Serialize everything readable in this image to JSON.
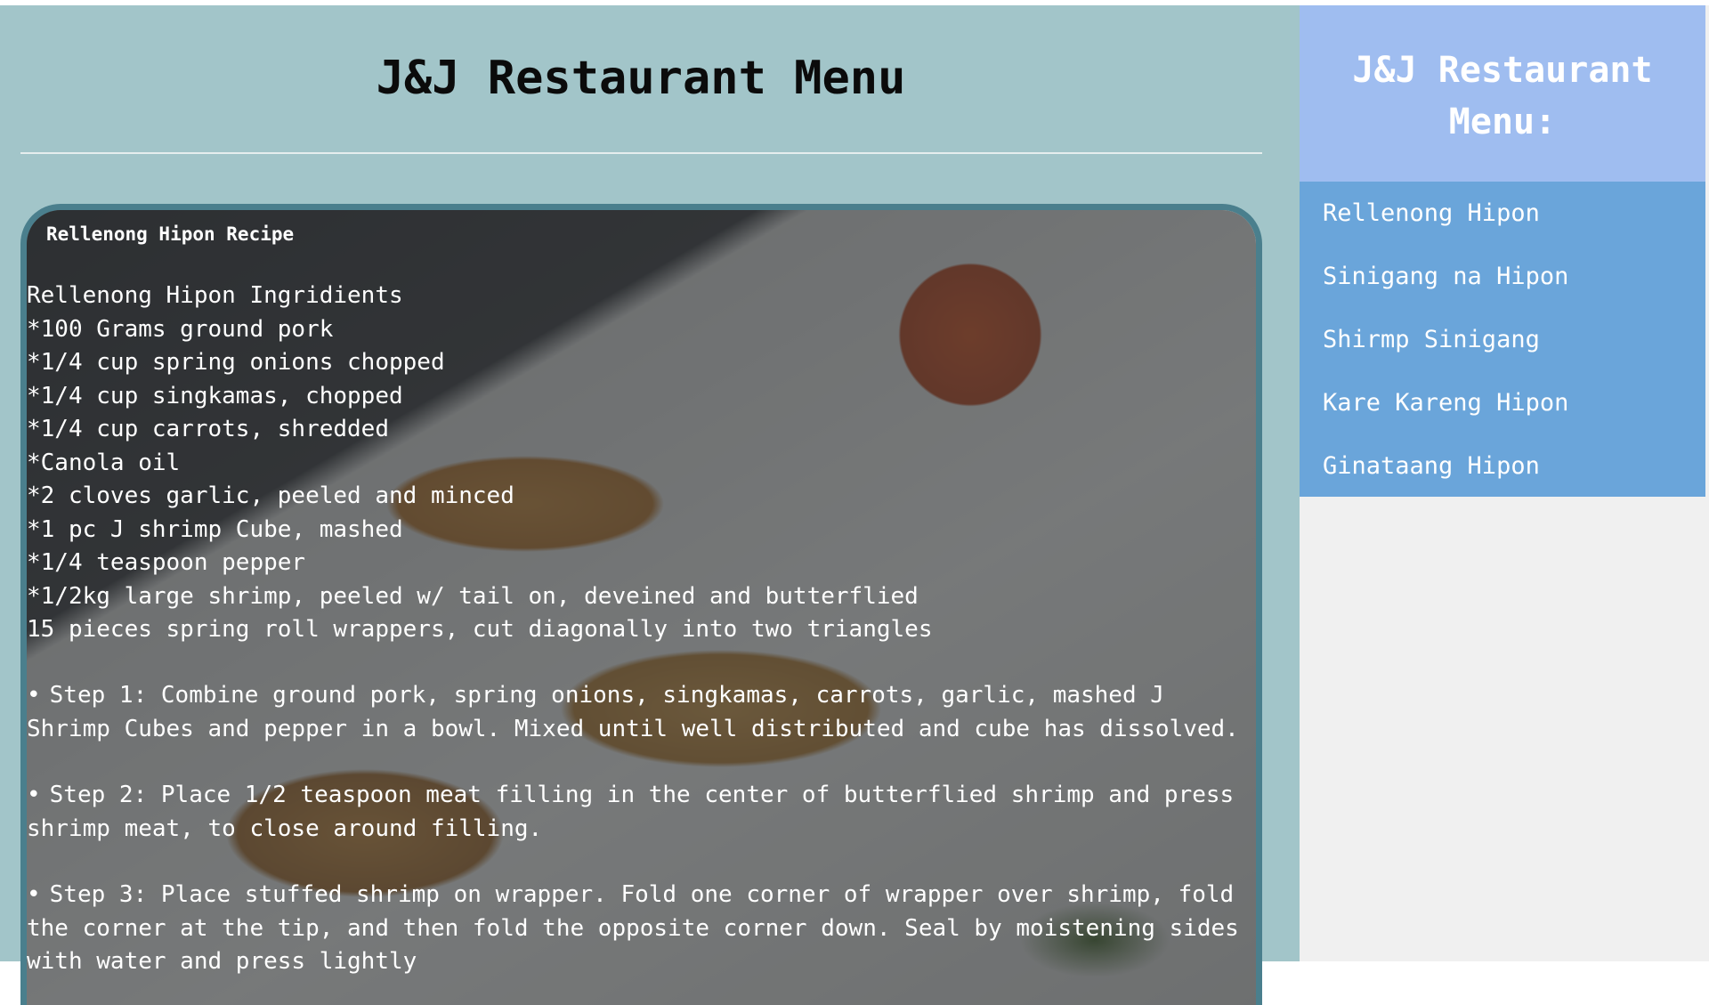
{
  "page": {
    "title": "J&J Restaurant Menu"
  },
  "recipe": {
    "heading": "Rellenong Hipon Recipe",
    "ingredients": [
      "Rellenong Hipon Ingridients",
      "*100 Grams ground pork",
      "*1/4 cup spring onions chopped",
      "*1/4 cup singkamas, chopped",
      "*1/4 cup carrots, shredded",
      "*Canola oil",
      "*2 cloves garlic, peeled and minced",
      "*1 pc J shrimp Cube, mashed",
      "*1/4 teaspoon pepper",
      "*1/2kg large shrimp, peeled w/ tail on, deveined and butterflied",
      "15 pieces spring roll wrappers, cut diagonally into two triangles"
    ],
    "steps": [
      "Step 1: Combine ground pork, spring onions, singkamas, carrots, garlic, mashed J Shrimp Cubes and pepper in a bowl. Mixed until well distributed and cube has dissolved.",
      "Step 2: Place 1/2 teaspoon meat filling in the center of butterflied shrimp and press shrimp meat, to close around filling.",
      "Step 3: Place stuffed shrimp on wrapper. Fold one corner of wrapper over shrimp, fold the corner at the tip, and then fold the opposite corner down. Seal by moistening sides with water and press lightly"
    ],
    "bullet": "•"
  },
  "sidebar": {
    "title": "J&J Restaurant Menu:",
    "items": [
      "Rellenong Hipon",
      "Sinigang na Hipon",
      "Shirmp Sinigang",
      "Kare Kareng Hipon",
      "Ginataang Hipon"
    ]
  },
  "colors": {
    "main_bg": "#a2c5c9",
    "card_border": "#4a7f8d",
    "sidebar_header_bg": "#9fbdf0",
    "sidebar_nav_bg": "#6aa5da",
    "sidebar_bg": "#f0f0f0"
  }
}
